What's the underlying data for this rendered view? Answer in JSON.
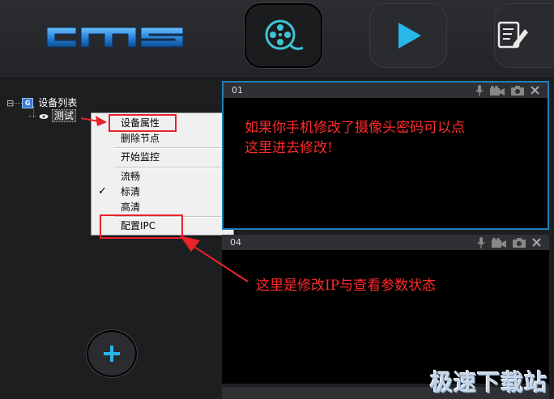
{
  "header": {
    "logo_text": "cms",
    "nav": [
      {
        "icon": "film-reel-icon",
        "active": true
      },
      {
        "icon": "play-icon",
        "active": false
      },
      {
        "icon": "edit-document-icon",
        "active": false
      }
    ]
  },
  "tree": {
    "root_expander": "⊟",
    "root_badge": "G",
    "root_label": "设备列表",
    "child_label": "测试"
  },
  "context_menu": {
    "items": [
      "设备属性",
      "删除节点",
      "开始监控",
      "流畅",
      "标清",
      "高清",
      "配置IPC"
    ],
    "checked": "标清"
  },
  "panes": [
    {
      "number": "01"
    },
    {
      "number": "04"
    }
  ],
  "annotations": {
    "top_note_line1": "如果你手机修改了摄像头密码可以点",
    "top_note_line2": "这里进去修改!",
    "bottom_note": "这里是修改IP与查看参数状态"
  },
  "watermark": "极速下载站",
  "colors": {
    "accent_blue": "#1f7fb8",
    "annotation_red": "#e8232a",
    "logo_blue": "#2f8fe0"
  }
}
